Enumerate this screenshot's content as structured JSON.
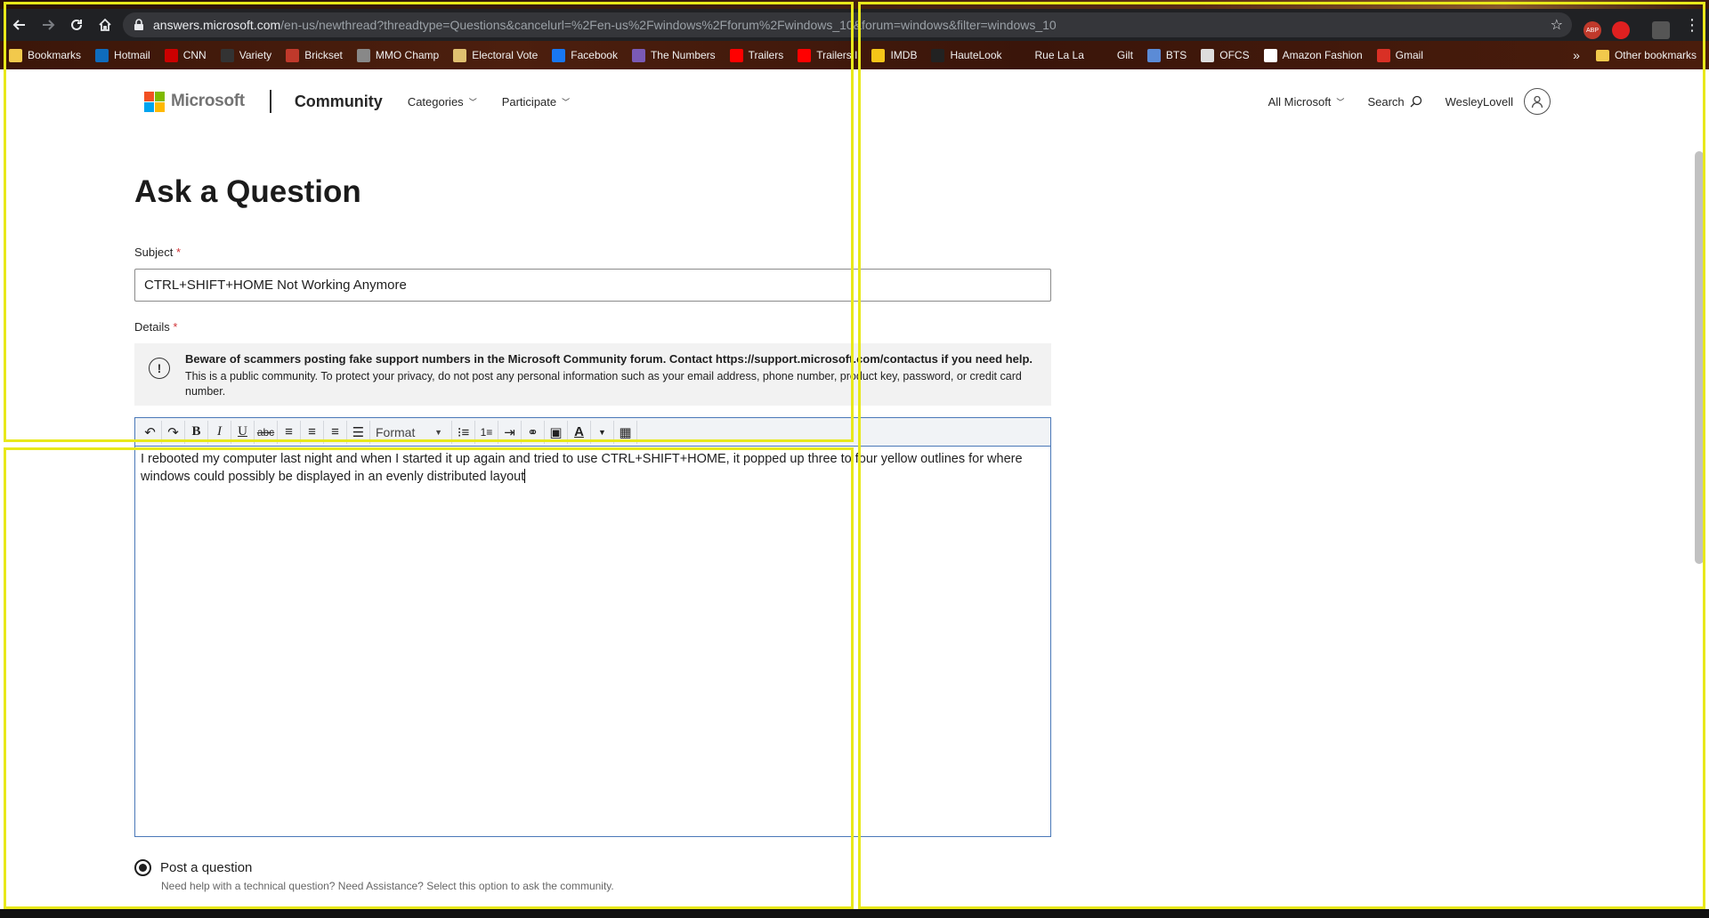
{
  "browser": {
    "url_host": "answers.microsoft.com",
    "url_path": "/en-us/newthread?threadtype=Questions&cancelurl=%2Fen-us%2Fwindows%2Fforum%2Fwindows_10&forum=windows&filter=windows_10",
    "bookmarks": [
      {
        "label": "Bookmarks",
        "icon": "folder-icon",
        "color": "#f2c94c"
      },
      {
        "label": "Hotmail",
        "icon": "outlook-icon",
        "color": "#0f6cbd"
      },
      {
        "label": "CNN",
        "icon": "cnn-icon",
        "color": "#cc0000"
      },
      {
        "label": "Variety",
        "icon": "variety-icon",
        "color": "#333333"
      },
      {
        "label": "Brickset",
        "icon": "brickset-icon",
        "color": "#c0392b"
      },
      {
        "label": "MMO Champ",
        "icon": "mmochamp-icon",
        "color": "#888888"
      },
      {
        "label": "Electoral Vote",
        "icon": "electoral-icon",
        "color": "#e0c070"
      },
      {
        "label": "Facebook",
        "icon": "facebook-icon",
        "color": "#1877f2"
      },
      {
        "label": "The Numbers",
        "icon": "numbers-icon",
        "color": "#7a5ab5"
      },
      {
        "label": "Trailers",
        "icon": "youtube-icon",
        "color": "#ff0000"
      },
      {
        "label": "Trailers I",
        "icon": "youtube-icon",
        "color": "#ff0000"
      },
      {
        "label": "IMDB",
        "icon": "imdb-icon",
        "color": "#f5c518"
      },
      {
        "label": "HauteLook",
        "icon": "hautelook-icon",
        "color": "#222222"
      },
      {
        "label": "Rue La La",
        "icon": "ruelala-icon",
        "color": "transparent"
      },
      {
        "label": "Gilt",
        "icon": "gilt-icon",
        "color": "transparent"
      },
      {
        "label": "BTS",
        "icon": "bts-icon",
        "color": "#5b8bd6"
      },
      {
        "label": "OFCS",
        "icon": "ofcs-icon",
        "color": "#dddddd"
      },
      {
        "label": "Amazon Fashion",
        "icon": "amazon-icon",
        "color": "#ffffff"
      },
      {
        "label": "Gmail",
        "icon": "gmail-icon",
        "color": "#d93025"
      }
    ],
    "more_chevron": "»",
    "other_bookmarks": "Other bookmarks"
  },
  "header": {
    "brand": "Microsoft",
    "site": "Community",
    "nav": [
      "Categories",
      "Participate"
    ],
    "all_microsoft": "All Microsoft",
    "search": "Search",
    "username": "WesleyLovell"
  },
  "form": {
    "title": "Ask a Question",
    "subject_label": "Subject",
    "required_mark": "*",
    "subject_value": "CTRL+SHIFT+HOME Not Working Anymore",
    "details_label": "Details",
    "notice_bold": "Beware of scammers posting fake support numbers in the Microsoft Community forum. Contact https://support.microsoft.com/contactus if you need help.",
    "notice_text": "This is a public community. To protect your privacy, do not post any personal information such as your email address, phone number, product key, password, or credit card number.",
    "format_label": "Format",
    "body_text": "I rebooted my computer last night and when I started it up again and tried to use CTRL+SHIFT+HOME, it popped up three to four yellow outlines for where windows could possibly be displayed in an evenly distributed layout",
    "post_option_label": "Post a question",
    "post_option_help": "Need help with a technical question? Need Assistance? Select this option to ask the community."
  },
  "colors": {
    "snap_outline": "#e8e81a",
    "ms_red": "#f25022",
    "ms_green": "#7fba00",
    "ms_blue": "#00a4ef",
    "ms_yellow": "#ffb900",
    "editor_border": "#4a78b8"
  }
}
